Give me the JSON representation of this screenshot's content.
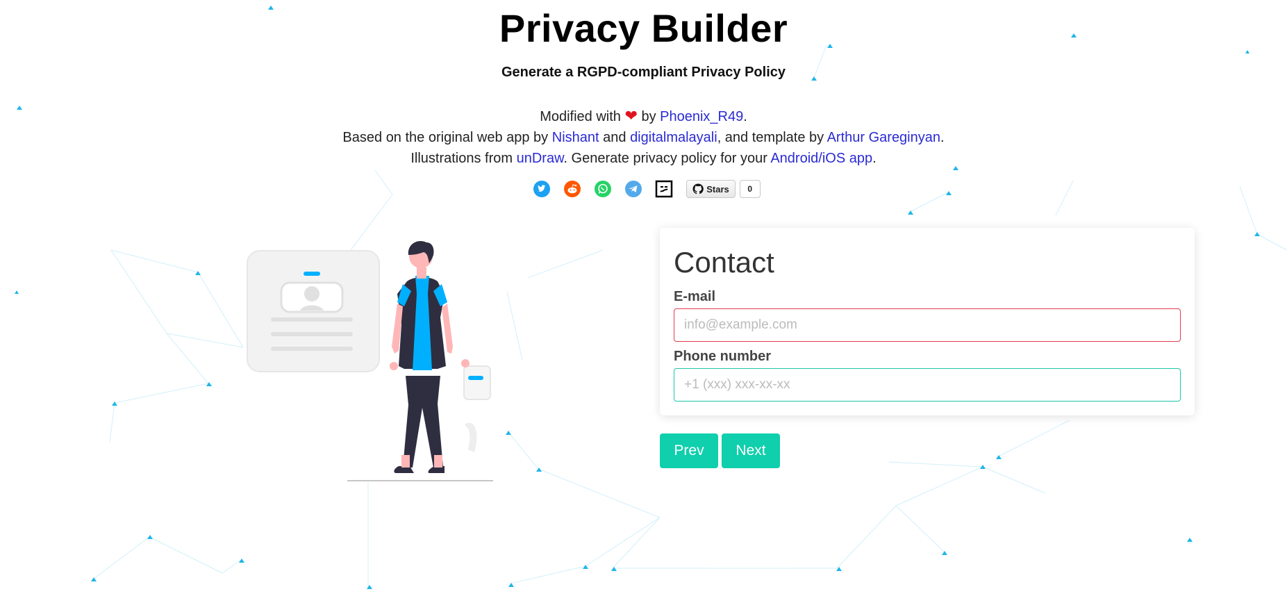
{
  "header": {
    "title": "Privacy Builder",
    "subtitle": "Generate a RGPD-compliant Privacy Policy"
  },
  "credits": {
    "line1_prefix": "Modified with",
    "heart": "❤",
    "line1_by": "by",
    "author_link": "Phoenix_R49",
    "line1_suffix": ".",
    "line2_prefix": "Based on the original web app by",
    "line2_link1": "Nishant",
    "line2_and": "and",
    "line2_link2": "digitalmalayali",
    "line2_mid": ", and template by",
    "line2_link3": "Arthur Gareginyan",
    "line2_suffix": ".",
    "line3_prefix": "Illustrations from",
    "line3_link1": "unDraw",
    "line3_mid": ". Generate privacy policy for your",
    "line3_link2": "Android/iOS app",
    "line3_suffix": "."
  },
  "social": {
    "icons": [
      "twitter-icon",
      "reddit-icon",
      "whatsapp-icon",
      "telegram-icon",
      "app-icon"
    ],
    "github_label": "Stars",
    "github_count": "0"
  },
  "form": {
    "section_title": "Contact",
    "email_label": "E-mail",
    "email_placeholder": "info@example.com",
    "phone_label": "Phone number",
    "phone_placeholder": "+1 (xxx) xxx-xx-xx"
  },
  "buttons": {
    "prev": "Prev",
    "next": "Next"
  },
  "colors": {
    "accent": "#0fcfac",
    "link": "#2a2ad4",
    "error_border": "#e23b4e",
    "valid_border": "#1cc7a8"
  }
}
